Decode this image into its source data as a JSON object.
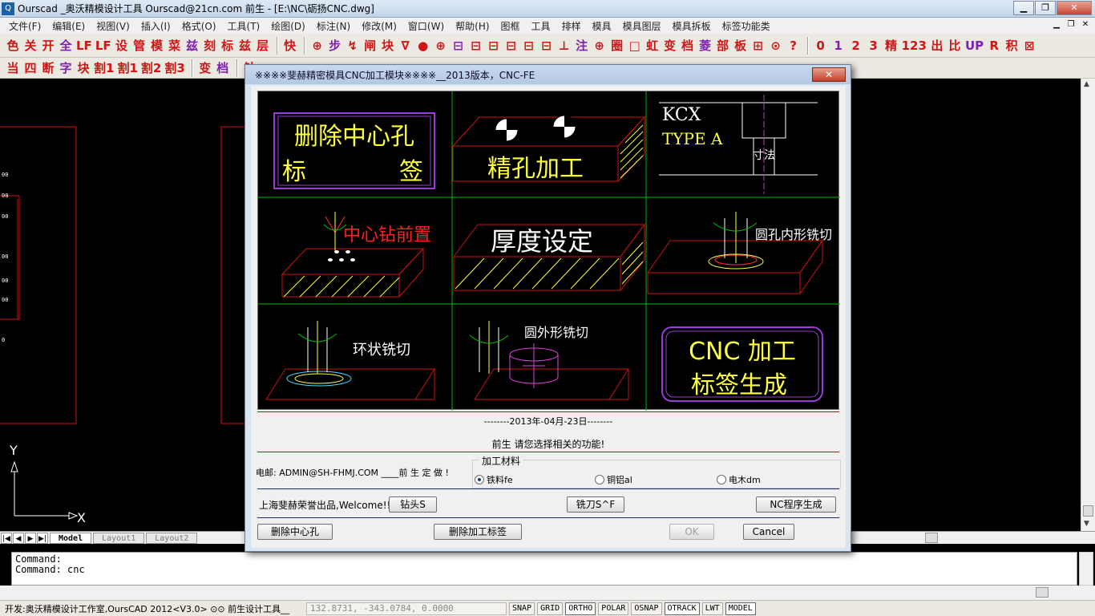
{
  "window": {
    "title": "Ourscad _奥沃精模设计工具 Ourscad@21cn.com 前生 - [E:\\NC\\砺扬CNC.dwg]",
    "app_icon": "Q"
  },
  "menu": {
    "items": [
      "文件(F)",
      "编辑(E)",
      "视图(V)",
      "插入(I)",
      "格式(O)",
      "工具(T)",
      "绘图(D)",
      "标注(N)",
      "修改(M)",
      "窗口(W)",
      "帮助(H)",
      "图框",
      "工具",
      "排样",
      "模具",
      "模具图层",
      "模具拆板",
      "标签功能类"
    ]
  },
  "toolbar1": {
    "items": [
      "色",
      "关",
      "开",
      "全",
      "LF",
      "LF",
      "设",
      "管",
      "模",
      "菜",
      "兹",
      "刻",
      "标",
      "兹",
      "层",
      "快",
      "⊕",
      "步",
      "↯",
      "闸",
      "块",
      "∇",
      "●",
      "⊕",
      "⊟",
      "⊟",
      "⊟",
      "⊟",
      "⊟",
      "⊟",
      "⊥",
      "注",
      "⊕",
      "圈",
      "□",
      "虹",
      "变",
      "档",
      "菱",
      "部",
      "板",
      "⊞",
      "⊙",
      "?",
      "0",
      "1",
      "2",
      "3",
      "精",
      "123",
      "出",
      "比",
      "UP",
      "R",
      "积",
      "⊠"
    ]
  },
  "toolbar2": {
    "items": [
      "当",
      "四",
      "断",
      "字",
      "块",
      "割1",
      "割1",
      "割2",
      "割3",
      "变",
      "档",
      "钻"
    ]
  },
  "dialog": {
    "title": "※※※※斐赫精密模具CNC加工模块※※※※__2013版本，CNC-FE",
    "close_label": "✕",
    "panels": {
      "p1_line1": "删除中心孔",
      "p1_line2a": "标",
      "p1_line2b": "签",
      "p2": "精孔加工",
      "p3_line1": "KCX",
      "p3_line2": "TYPE A",
      "p3_dim": "寸法",
      "p4": "中心钻前置",
      "p5": "厚度设定",
      "p6": "圆孔内形铣切",
      "p7": "环状铣切",
      "p8": "圆外形铣切",
      "p9_line1": "CNC 加工",
      "p9_line2": "标签生成"
    },
    "date_text": "--------2013年-04月-23日--------",
    "greeting": "前生 请您选择相关的功能!",
    "email": "电邮: ADMIN@SH-FHMJ.COM ____前 生 定 做 !",
    "material_group": {
      "legend": "加工材料",
      "options": [
        {
          "label": "铁料fe",
          "checked": true
        },
        {
          "label": "铜铝al",
          "checked": false
        },
        {
          "label": "电木dm",
          "checked": false
        }
      ]
    },
    "brand": "上海斐赫荣誉出品,Welcome!!",
    "buttons": {
      "drill": "钻头S",
      "mill": "铣刀S^F",
      "nc_gen": "NC程序生成",
      "del_center": "删除中心孔",
      "del_label": "删除加工标签",
      "ok": "OK",
      "cancel": "Cancel"
    }
  },
  "drawing": {
    "axis_y": "Y",
    "axis_x": "X",
    "left_labels": [
      "00",
      "00",
      "00",
      "00",
      "00",
      "00",
      "0"
    ]
  },
  "layout_tabs": [
    "Model",
    "Layout1",
    "Layout2"
  ],
  "command": {
    "line1": "Command:",
    "line2": "Command: cnc"
  },
  "status": {
    "dev": "开发:奥沃精模设计工作室,OursCAD 2012<V3.0> ⊙⊙ 前生设计工具__",
    "coords": "132.8731, -343.0784, 0.0000",
    "toggles": [
      {
        "label": "SNAP",
        "on": false
      },
      {
        "label": "GRID",
        "on": false
      },
      {
        "label": "ORTHO",
        "on": true
      },
      {
        "label": "POLAR",
        "on": false
      },
      {
        "label": "OSNAP",
        "on": false
      },
      {
        "label": "OTRACK",
        "on": true
      },
      {
        "label": "LWT",
        "on": false
      },
      {
        "label": "MODEL",
        "on": true
      }
    ]
  },
  "colors": {
    "accent_red": "#ff2020",
    "grid_green": "#00c000",
    "label_yellow": "#ffff40",
    "frame_purple": "#9a3bd8"
  }
}
